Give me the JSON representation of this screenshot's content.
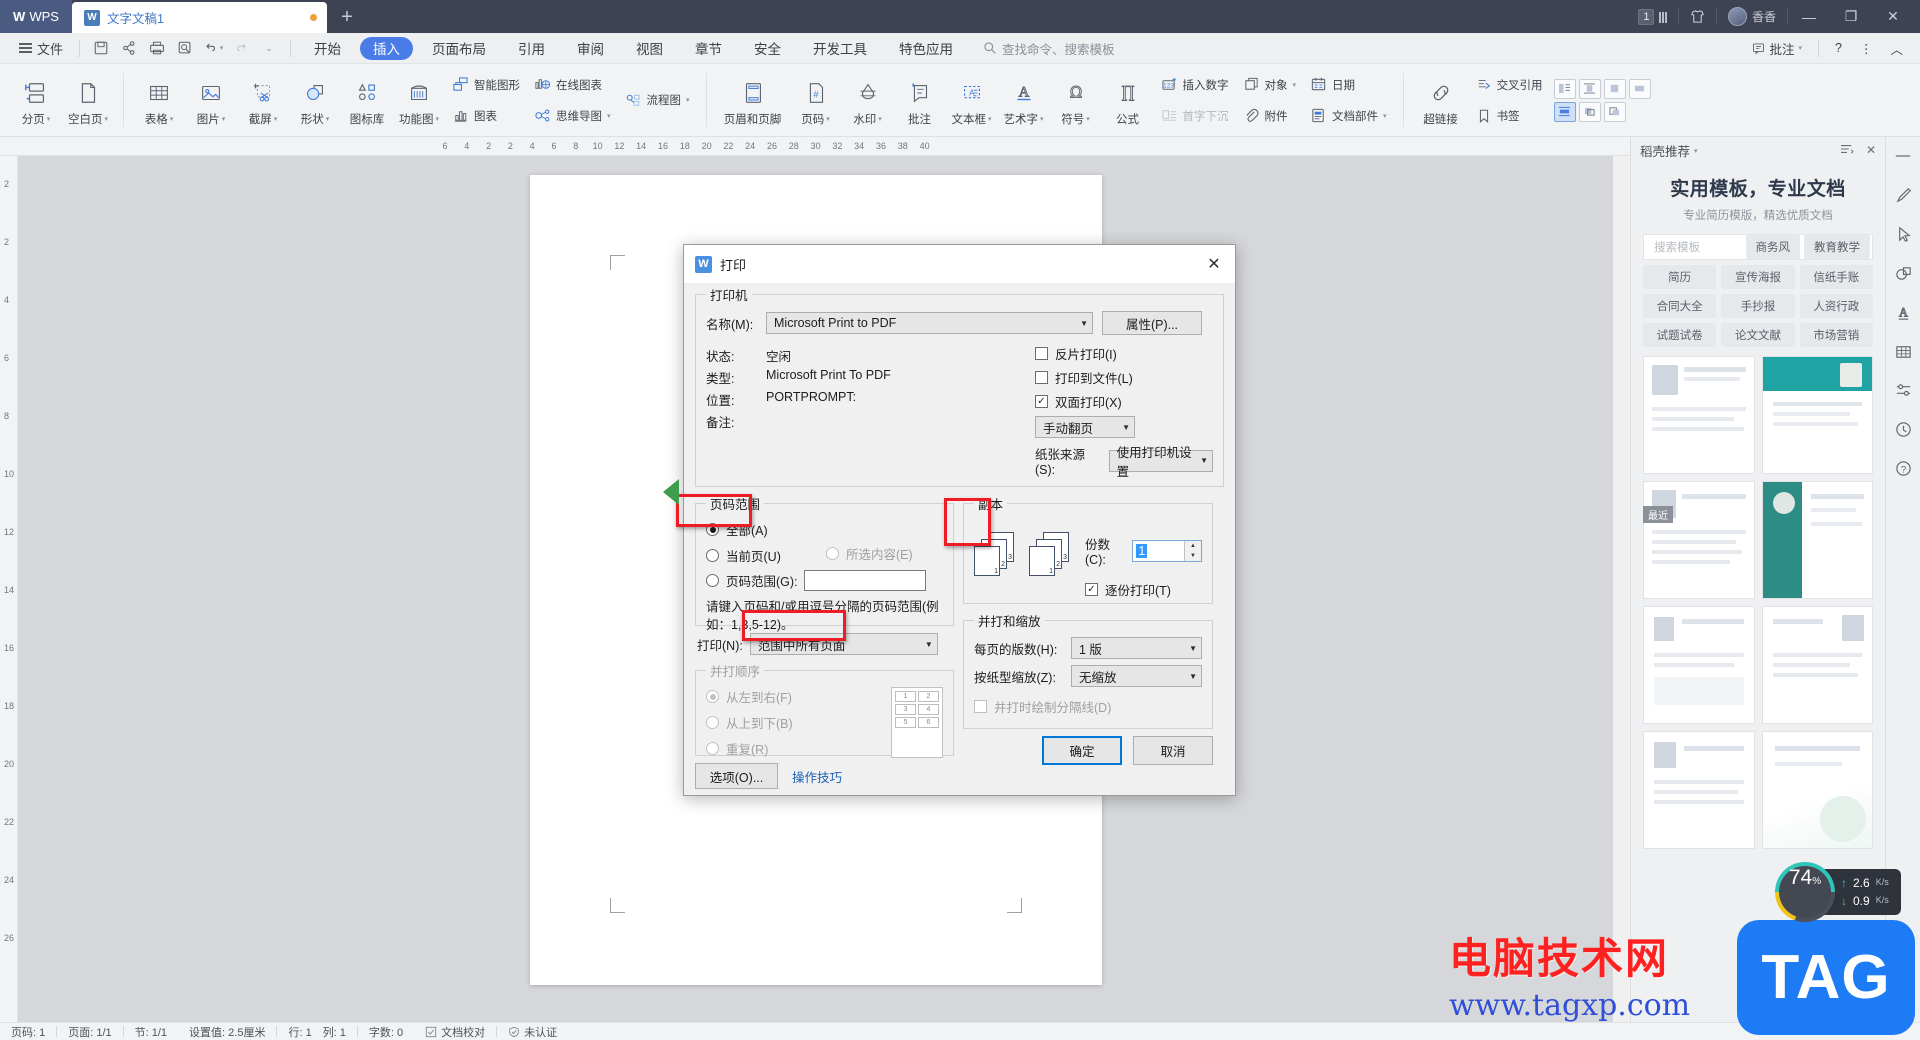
{
  "titlebar": {
    "wps_label": "WPS",
    "tab_title": "文字文稿1",
    "new_tab": "+",
    "page_badge": "1",
    "user_name": "香香",
    "minimize": "—",
    "restore": "❐",
    "close": "✕"
  },
  "menu": {
    "file": "文件",
    "quick": [
      "save-icon",
      "share-icon",
      "print-icon",
      "print-preview-icon",
      "undo-icon",
      "redo-icon",
      "customize-icon"
    ],
    "tabs": [
      {
        "label": "开始",
        "active": false
      },
      {
        "label": "插入",
        "active": true
      },
      {
        "label": "页面布局",
        "active": false
      },
      {
        "label": "引用",
        "active": false
      },
      {
        "label": "审阅",
        "active": false
      },
      {
        "label": "视图",
        "active": false
      },
      {
        "label": "章节",
        "active": false
      },
      {
        "label": "安全",
        "active": false
      },
      {
        "label": "开发工具",
        "active": false
      },
      {
        "label": "特色应用",
        "active": false
      }
    ],
    "search_placeholder": "查找命令、搜索模板",
    "right": {
      "comment": "批注",
      "help": "?",
      "more": "⋮",
      "collapse": "︿"
    }
  },
  "ribbon": {
    "groups": [
      {
        "big": [
          {
            "label": "分页",
            "icon": "page-break-icon",
            "caret": true
          },
          {
            "label": "空白页",
            "icon": "blank-page-icon",
            "caret": true
          }
        ]
      },
      {
        "big": [
          {
            "label": "表格",
            "icon": "table-icon",
            "caret": true
          },
          {
            "label": "图片",
            "icon": "picture-icon",
            "caret": true
          },
          {
            "label": "截屏",
            "icon": "screenshot-icon",
            "caret": true
          },
          {
            "label": "形状",
            "icon": "shapes-icon",
            "caret": true
          },
          {
            "label": "图标库",
            "icon": "icon-library-icon",
            "caret": false
          },
          {
            "label": "功能图",
            "icon": "function-chart-icon",
            "caret": true
          }
        ],
        "small": [
          {
            "label": "智能图形",
            "icon": "smart-art-icon",
            "caret": false
          },
          {
            "label": "图表",
            "icon": "chart-icon",
            "caret": false
          },
          {
            "label": "在线图表",
            "icon": "online-chart-icon",
            "caret": false
          },
          {
            "label": "思维导图",
            "icon": "mind-map-icon",
            "caret": true
          },
          {
            "label": "流程图",
            "icon": "flowchart-icon",
            "caret": true
          }
        ]
      },
      {
        "big": [
          {
            "label": "页眉和页脚",
            "icon": "header-footer-icon",
            "caret": false
          },
          {
            "label": "页码",
            "icon": "page-number-icon",
            "caret": true
          },
          {
            "label": "水印",
            "icon": "watermark-icon",
            "caret": true
          },
          {
            "label": "批注",
            "icon": "comment-icon",
            "caret": false
          },
          {
            "label": "文本框",
            "icon": "textbox-icon",
            "caret": true
          },
          {
            "label": "艺术字",
            "icon": "wordart-icon",
            "caret": true
          },
          {
            "label": "符号",
            "icon": "symbol-icon",
            "caret": true
          },
          {
            "label": "公式",
            "icon": "formula-icon",
            "caret": false
          }
        ],
        "small": [
          {
            "label": "插入数字",
            "icon": "insert-number-icon",
            "dim": false
          },
          {
            "label": "首字下沉",
            "icon": "drop-cap-icon",
            "dim": true
          },
          {
            "label": "对象",
            "icon": "object-icon",
            "caret": true,
            "dim": false
          },
          {
            "label": "附件",
            "icon": "attachment-icon",
            "dim": false
          },
          {
            "label": "日期",
            "icon": "date-icon",
            "dim": false
          },
          {
            "label": "文档部件",
            "icon": "doc-parts-icon",
            "caret": true,
            "dim": false
          }
        ]
      },
      {
        "big": [
          {
            "label": "超链接",
            "icon": "hyperlink-icon",
            "caret": false
          }
        ],
        "small": [
          {
            "label": "交叉引用",
            "icon": "cross-reference-icon"
          },
          {
            "label": "书签",
            "icon": "bookmark-icon"
          }
        ]
      }
    ]
  },
  "ruler": {
    "h_ticks": [
      "6",
      "4",
      "2",
      "2",
      "4",
      "6",
      "8",
      "10",
      "12",
      "14",
      "16",
      "18",
      "20",
      "22",
      "24",
      "26",
      "28",
      "30",
      "32",
      "34",
      "36",
      "38",
      "40"
    ],
    "v_ticks": [
      "2",
      "2",
      "4",
      "6",
      "8",
      "10",
      "12",
      "14",
      "16",
      "18",
      "20",
      "22",
      "24",
      "26"
    ]
  },
  "dialog": {
    "title": "打印",
    "close": "✕",
    "printer_group": {
      "legend": "打印机",
      "name_label": "名称(M):",
      "name_value": "Microsoft Print to PDF",
      "properties_button": "属性(P)...",
      "status_label": "状态:",
      "status_value": "空闲",
      "type_label": "类型:",
      "type_value": "Microsoft Print To PDF",
      "location_label": "位置:",
      "location_value": "PORTPROMPT:",
      "remark_label": "备注:",
      "remark_value": "",
      "checkboxes": [
        {
          "label": "反片打印(I)",
          "checked": false
        },
        {
          "label": "打印到文件(L)",
          "checked": false
        },
        {
          "label": "双面打印(X)",
          "checked": true
        }
      ],
      "duplex_combo": "手动翻页",
      "paper_source_label": "纸张来源(S):",
      "paper_source_value": "使用打印机设置"
    },
    "page_range": {
      "legend": "页码范围",
      "options": [
        {
          "label": "全部(A)",
          "selected": true,
          "disabled": false,
          "highlighted": true
        },
        {
          "label": "当前页(U)",
          "selected": false,
          "disabled": false,
          "highlighted": false
        },
        {
          "label": "所选内容(E)",
          "selected": false,
          "disabled": true,
          "highlighted": false
        },
        {
          "label": "页码范围(G):",
          "selected": false,
          "disabled": false,
          "highlighted": false
        }
      ],
      "range_input_value": "",
      "hint": "请键入页码和/或用逗号分隔的页码范围(例如：1,3,5-12)。"
    },
    "print_what": {
      "label": "打印(N):",
      "value": "范围中所有页面",
      "highlighted": true
    },
    "order_group": {
      "legend": "并打顺序",
      "options": [
        {
          "label": "从左到右(F)",
          "selected": true
        },
        {
          "label": "从上到下(B)",
          "selected": false
        },
        {
          "label": "重复(R)",
          "selected": false
        }
      ],
      "grid": [
        "1",
        "2",
        "3",
        "4",
        "5",
        "6"
      ]
    },
    "options_button": "选项(O)...",
    "tips_link": "操作技巧",
    "copies_group": {
      "legend": "副本",
      "copies_label": "份数(C):",
      "copies_value": "1",
      "copies_highlighted": true,
      "collate_label": "逐份打印(T)",
      "collate_checked": true,
      "preview_page_numbers": [
        "1",
        "2",
        "3"
      ]
    },
    "zoom_group": {
      "legend": "并打和缩放",
      "pages_per_sheet_label": "每页的版数(H):",
      "pages_per_sheet_value": "1 版",
      "scale_label": "按纸型缩放(Z):",
      "scale_value": "无缩放",
      "divider_label": "并打时绘制分隔线(D)",
      "divider_checked": false
    },
    "ok_button": "确定",
    "cancel_button": "取消"
  },
  "right_panel": {
    "header_title": "稻壳推荐",
    "menu_icon": "list-menu-icon",
    "close_icon": "close-icon",
    "headline": "实用模板，专业文档",
    "subhead": "专业简历模版，精选优质文档",
    "search_placeholder": "搜索模板",
    "top_chips": [
      "商务风",
      "教育教学"
    ],
    "chip_rows": [
      [
        "简历",
        "宣传海报",
        "信纸手账"
      ],
      [
        "合同大全",
        "手抄报",
        "人资行政"
      ],
      [
        "试题试卷",
        "论文文献",
        "市场营销"
      ]
    ],
    "recent_badge": "最近"
  },
  "rail_icons": [
    "pen-icon",
    "cursor-icon",
    "shape-icon",
    "text-style-icon",
    "table-icon",
    "settings-icon",
    "history-icon",
    "help-icon",
    "target-icon"
  ],
  "statusbar": {
    "items": [
      "页码: 1",
      "页面: 1/1",
      "节: 1/1",
      "设置值: 2.5厘米",
      "行: 1",
      "列: 1",
      "字数: 0",
      "文档校对",
      "未认证"
    ]
  },
  "network_monitor": {
    "percent": "74",
    "percent_unit": "%",
    "upload": "2.6",
    "upload_unit": "K/s",
    "download": "0.9",
    "download_unit": "K/s"
  },
  "watermark": {
    "site_cn": "电脑技术网",
    "site_url": "www.tagxp.com",
    "logo": "TAG"
  },
  "colors": {
    "accent": "#4a7ce8",
    "titlebar": "#3d4352",
    "highlight_red": "#ee1c25",
    "green_arrow": "#3f9e4d",
    "dialog_bg": "#f0f0f0",
    "link_blue": "#2f4fd8"
  }
}
